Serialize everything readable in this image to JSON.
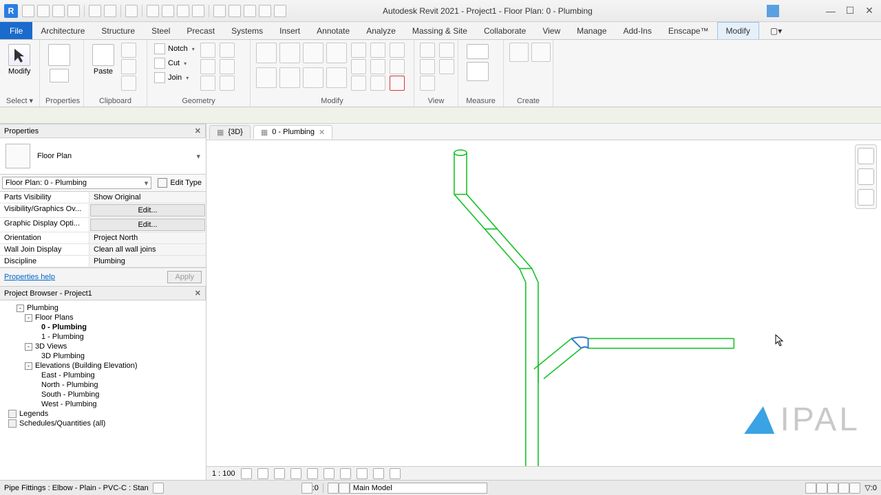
{
  "app": {
    "title": "Autodesk Revit 2021 - Project1 - Floor Plan: 0 - Plumbing",
    "icon_letter": "R"
  },
  "ribbon_tabs": {
    "file": "File",
    "items": [
      "Architecture",
      "Structure",
      "Steel",
      "Precast",
      "Systems",
      "Insert",
      "Annotate",
      "Analyze",
      "Massing & Site",
      "Collaborate",
      "View",
      "Manage",
      "Add-Ins",
      "Enscape™",
      "Modify"
    ],
    "active": "Modify"
  },
  "ribbon_panels": {
    "select": {
      "label": "Select ▾",
      "modify": "Modify"
    },
    "properties": "Properties",
    "clipboard": {
      "label": "Clipboard",
      "paste": "Paste"
    },
    "geometry": {
      "label": "Geometry",
      "notch": "Notch",
      "cut": "Cut",
      "join": "Join"
    },
    "modify": "Modify",
    "view": "View",
    "measure": "Measure",
    "create": "Create"
  },
  "properties": {
    "title": "Properties",
    "type": "Floor Plan",
    "instance": "Floor Plan: 0 - Plumbing",
    "edit_type": "Edit Type",
    "rows": [
      {
        "k": "Parts Visibility",
        "v": "Show Original"
      },
      {
        "k": "Visibility/Graphics Ov...",
        "v": "Edit...",
        "btn": true
      },
      {
        "k": "Graphic Display Opti...",
        "v": "Edit...",
        "btn": true
      },
      {
        "k": "Orientation",
        "v": "Project North"
      },
      {
        "k": "Wall Join Display",
        "v": "Clean all wall joins"
      },
      {
        "k": "Discipline",
        "v": "Plumbing"
      }
    ],
    "help": "Properties help",
    "apply": "Apply"
  },
  "browser": {
    "title": "Project Browser - Project1",
    "nodes": [
      {
        "indent": 2,
        "tw": "-",
        "label": "Plumbing"
      },
      {
        "indent": 3,
        "tw": "-",
        "label": "Floor Plans"
      },
      {
        "indent": 5,
        "label": "0 - Plumbing",
        "bold": true
      },
      {
        "indent": 5,
        "label": "1 - Plumbing"
      },
      {
        "indent": 3,
        "tw": "-",
        "label": "3D Views"
      },
      {
        "indent": 5,
        "label": "3D Plumbing"
      },
      {
        "indent": 3,
        "tw": "-",
        "label": "Elevations (Building Elevation)"
      },
      {
        "indent": 5,
        "label": "East - Plumbing"
      },
      {
        "indent": 5,
        "label": "North - Plumbing"
      },
      {
        "indent": 5,
        "label": "South - Plumbing"
      },
      {
        "indent": 5,
        "label": "West - Plumbing"
      },
      {
        "indent": 1,
        "icon": true,
        "label": "Legends"
      },
      {
        "indent": 1,
        "icon": true,
        "label": "Schedules/Quantities (all)"
      }
    ]
  },
  "view_tabs": [
    {
      "label": "{3D}",
      "active": false,
      "close": false
    },
    {
      "label": "0 - Plumbing",
      "active": true,
      "close": true
    }
  ],
  "view_controls": {
    "scale": "1 : 100"
  },
  "status": {
    "hint": "Pipe Fittings : Elbow - Plain - PVC-C : Stan",
    "coord": ":0",
    "model": "Main Model"
  },
  "watermark": "IPAL",
  "colors": {
    "pipe": "#18c22a",
    "sel": "#2e7bd1"
  }
}
